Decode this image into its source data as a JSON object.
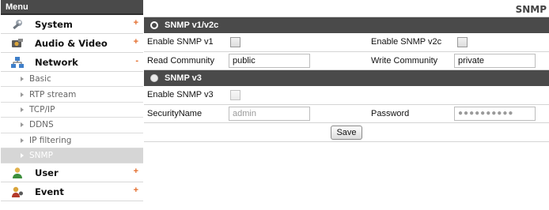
{
  "sidebar": {
    "header": "Menu",
    "categories": {
      "system": {
        "label": "System",
        "toggle": "+",
        "icon": "wrench-icon"
      },
      "audio_video": {
        "label": "Audio & Video",
        "toggle": "+",
        "icon": "camera-icon"
      },
      "network": {
        "label": "Network",
        "toggle": "-",
        "icon": "network-icon"
      },
      "user": {
        "label": "User",
        "toggle": "+",
        "icon": "user-icon"
      },
      "event": {
        "label": "Event",
        "toggle": "+",
        "icon": "event-icon"
      }
    },
    "network_items": [
      {
        "label": "Basic"
      },
      {
        "label": "RTP stream"
      },
      {
        "label": "TCP/IP"
      },
      {
        "label": "DDNS"
      },
      {
        "label": "IP filtering"
      },
      {
        "label": "SNMP",
        "active": true
      }
    ]
  },
  "page": {
    "title": "SNMP"
  },
  "snmp_v1v2c": {
    "header": "SNMP v1/v2c",
    "enable_v1_label": "Enable SNMP v1",
    "enable_v2c_label": "Enable  SNMP v2c",
    "read_community_label": "Read Community",
    "read_community_value": "public",
    "write_community_label": "Write Community",
    "write_community_value": "private"
  },
  "snmp_v3": {
    "header": "SNMP v3",
    "enable_v3_label": "Enable  SNMP v3",
    "security_name_label": "SecurityName",
    "security_name_value": "admin",
    "password_label": "Password",
    "password_value": "●●●●●●●●●●"
  },
  "actions": {
    "save_label": "Save"
  }
}
